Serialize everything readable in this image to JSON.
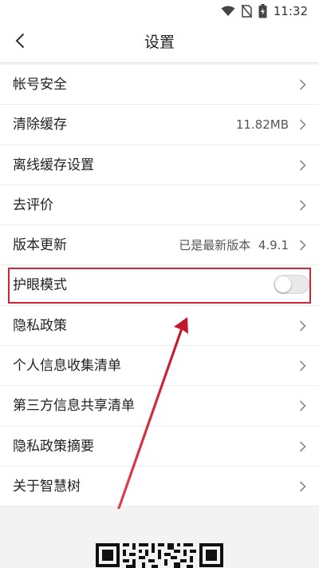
{
  "status_bar": {
    "time": "11:32",
    "icons": [
      "wifi-icon",
      "no-sim-icon",
      "battery-charging-icon"
    ]
  },
  "header": {
    "title": "设置",
    "back_icon": "chevron-left-icon"
  },
  "settings": [
    {
      "label": "帐号安全",
      "value": ""
    },
    {
      "label": "清除缓存",
      "value": "11.82MB"
    },
    {
      "label": "离线缓存设置",
      "value": ""
    },
    {
      "label": "去评价",
      "value": ""
    },
    {
      "label": "版本更新",
      "value": "已是最新版本  4.9.1"
    },
    {
      "label": "护眼模式",
      "toggle": false
    },
    {
      "label": "隐私政策",
      "value": ""
    },
    {
      "label": "个人信息收集清单",
      "value": ""
    },
    {
      "label": "第三方信息共享清单",
      "value": ""
    },
    {
      "label": "隐私政策摘要",
      "value": ""
    },
    {
      "label": "关于智慧树",
      "value": ""
    }
  ],
  "colors": {
    "highlight": "#c8283a",
    "arrow": "#d42030",
    "background": "#f3f3f3"
  }
}
